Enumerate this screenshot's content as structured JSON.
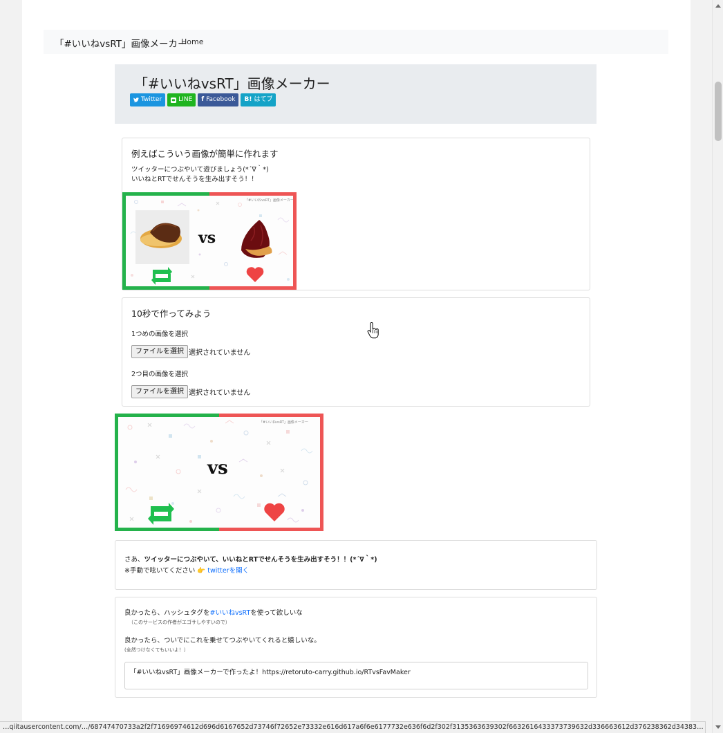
{
  "navbar": {
    "brand": "「#いいねvsRT」画像メーカー",
    "home": "Home"
  },
  "header": {
    "title": "「#いいねvsRT」画像メーカー",
    "share": [
      {
        "label": "Twitter",
        "icon": "twitter-icon",
        "color": "#1b95e0"
      },
      {
        "label": "LINE",
        "icon": "line-icon",
        "color": "#1fb41f"
      },
      {
        "label": "Facebook",
        "icon": "facebook-icon",
        "color": "#3b5998"
      },
      {
        "label": "はてブ",
        "icon": "hatena-icon",
        "color": "#14a3c7"
      }
    ]
  },
  "example": {
    "title": "例えばこういう画像が簡単に作れます",
    "line1": "ツイッターにつぶやいて遊びましょう(*´∇｀*)",
    "line2": "いいねとRTでせんそうを生み出すそう！！",
    "image": {
      "vs": "vs",
      "caption": "「#いいねvsRT」画像メーカー"
    }
  },
  "maker": {
    "title": "10秒で作ってみよう",
    "file1_label": "1つめの画像を選択",
    "file2_label": "2つ目の画像を選択",
    "file_button": "ファイルを選択",
    "file_status": "選択されていません"
  },
  "preview": {
    "vs": "vs",
    "caption": "「#いいねvsRT」画像メーカー"
  },
  "tweet": {
    "prefix": "さあ、",
    "bold": "ツイッターにつぶやいて、いいねとRTでせんそうを生み出すそう！！(*´∇｀*)",
    "manual": "※手動で呟いてください 👉",
    "link": "twitterを開く"
  },
  "hashtag": {
    "line1_pre": "良かったら、ハッシュタグを",
    "line1_tag": "#いいねvsRT",
    "line1_post": "を使って欲しいな",
    "sub1": "（このサービスの作者がエゴサしやすいので）",
    "line2": "良かったら、ついでにこれを乗せてつぶやいてくれると嬉しいな。",
    "sub2": "(全然つけなくてもいいよ！）",
    "textarea": "「#いいねvsRT」画像メーカーで作ったよ！https://retoruto-carry.github.io/RTvsFavMaker"
  },
  "status_bar": "…qiitausercontent.com/…/68747470733a2f2f71696974612d696d6167652d73746f72652e73332e616d617a6f6e6177732e636f6d2f302f3135363639302f6632616433373739632d336663612d376238362d34383…",
  "colors": {
    "rt_green": "#24b24b",
    "fav_red": "#ee5555"
  }
}
